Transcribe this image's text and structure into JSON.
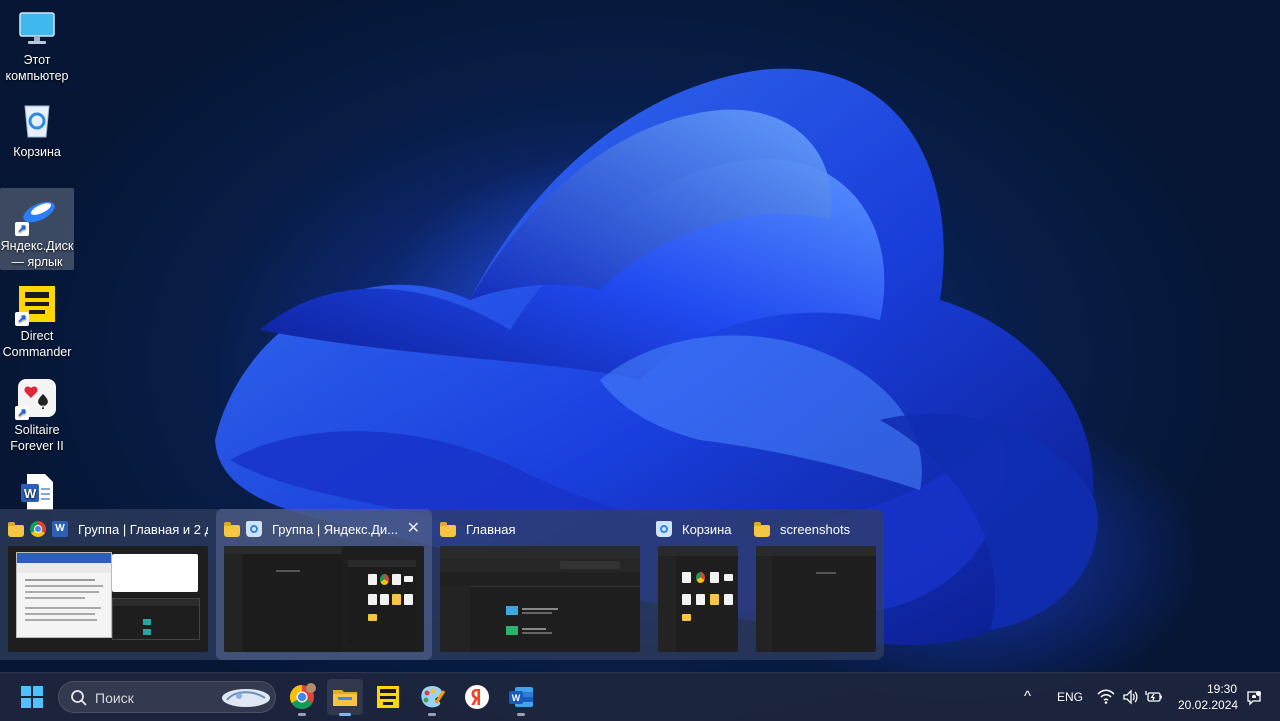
{
  "desktop": {
    "icons": [
      {
        "label": "Этот компьютер",
        "icon": "monitor-icon",
        "shortcut": false
      },
      {
        "label": "Корзина",
        "icon": "recycle-bin-icon",
        "shortcut": false
      },
      {
        "label": "Яндекс.Диск — ярлык",
        "icon": "yandex-disk-icon",
        "shortcut": true,
        "selected": true
      },
      {
        "label": "Direct Commander",
        "icon": "direct-commander-icon",
        "shortcut": true
      },
      {
        "label": "Solitaire Forever II",
        "icon": "solitaire-icon",
        "shortcut": true
      },
      {
        "label": "",
        "icon": "word-document-icon",
        "shortcut": false
      }
    ]
  },
  "switcher": {
    "windows": [
      {
        "title": "Группа | Главная и 2 д...",
        "icons": [
          "folder-icon",
          "chrome-icon",
          "word-icon"
        ],
        "active": false
      },
      {
        "title": "Группа | Яндекс.Ди...",
        "icons": [
          "folder-icon",
          "recycle-bin-icon"
        ],
        "active": true,
        "close": "✕"
      },
      {
        "title": "Главная",
        "icons": [
          "folder-icon"
        ],
        "active": false
      },
      {
        "title": "Корзина",
        "icons": [
          "recycle-bin-icon"
        ],
        "active": false
      },
      {
        "title": "screenshots",
        "icons": [
          "folder-icon"
        ],
        "active": false
      }
    ]
  },
  "taskbar": {
    "search_placeholder": "Поиск",
    "apps": [
      "start-icon",
      "chrome-icon",
      "file-explorer-icon",
      "direct-commander-icon",
      "paint-icon",
      "yandex-browser-icon",
      "word-icon"
    ],
    "active_app": "file-explorer-icon",
    "tray": {
      "chevron": "^",
      "language": "ENG",
      "time": "19:30",
      "date": "20.02.2024"
    }
  },
  "colors": {
    "accent": "#2b68ff",
    "taskbar": "#1e263e"
  }
}
